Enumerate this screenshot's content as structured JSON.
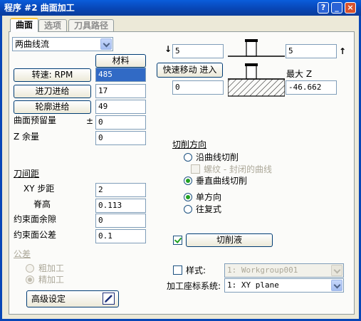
{
  "window": {
    "title": "程序 #2 曲面加工",
    "help_label": "?",
    "min_label": "_",
    "close_label": "×"
  },
  "tabs": [
    {
      "label": "曲面",
      "active": true
    },
    {
      "label": "选项",
      "active": false
    },
    {
      "label": "刀具路径",
      "active": false
    }
  ],
  "surface": {
    "mode_select": "两曲线流",
    "material_button": "材料",
    "speed_button": "转速: RPM",
    "speed_value": "485",
    "feed_button": "进刀进给",
    "feed_value": "17",
    "contour_feed_button": "轮廓进给",
    "contour_feed_value": "49",
    "stock_label": "曲面预留量",
    "stock_pm": "±",
    "stock_value": "0",
    "z_margin_label": "Z 余量",
    "z_margin_value": "0"
  },
  "stepover": {
    "title": "刀间距",
    "xy_step_label": "XY 步距",
    "xy_step_value": "2",
    "cusp_label": "脊高",
    "cusp_value": "0.113",
    "constraint_clearance_label": "约束面余隙",
    "constraint_clearance_value": "0",
    "constraint_tolerance_label": "约束面公差",
    "constraint_tolerance_value": "0.1"
  },
  "tolerance": {
    "title": "公差",
    "roughing_label": "粗加工",
    "finishing_label": "精加工",
    "selected": "finishing"
  },
  "advanced_button": "高级设定",
  "heights": {
    "top_left_value": "5",
    "top_right_value": "5",
    "rapid_button": "快速移动 进入",
    "bottom_left_value": "0",
    "max_z_label": "最大 Z",
    "max_z_value": "-46.662"
  },
  "cut_direction": {
    "title": "切削方向",
    "along_curve_label": "沿曲线切削",
    "spiral_label": "螺纹 - 封闭的曲线",
    "spiral_checked": false,
    "perpendicular_label": "垂直曲线切削",
    "selected_direction": "perpendicular",
    "one_way_label": "单方向",
    "zigzag_label": "往复式",
    "selected_pattern": "one_way"
  },
  "coolant": {
    "checked": true,
    "button_label": "切削液"
  },
  "style": {
    "label": "样式:",
    "checked": false,
    "value": "1: Workgroup001"
  },
  "wcs": {
    "label": "加工座标系统:",
    "value": "1: XY plane"
  },
  "colors": {
    "titlebar": "#0846b6",
    "dialog_bg": "#ece9d8",
    "selection": "#316ac5",
    "radio_dot": "#21a121",
    "tab_highlight": "#ffc83c"
  }
}
